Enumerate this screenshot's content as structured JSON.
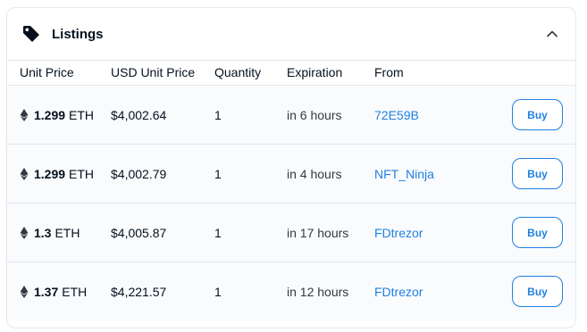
{
  "panel": {
    "title": "Listings",
    "icons": {
      "title": "price-tag-icon",
      "toggle": "chevron-up-icon",
      "currency": "ethereum-icon"
    }
  },
  "columns": [
    "Unit Price",
    "USD Unit Price",
    "Quantity",
    "Expiration",
    "From"
  ],
  "rows": [
    {
      "price": "1.299",
      "currency": "ETH",
      "usd": "$4,002.64",
      "quantity": "1",
      "expiration": "in 6 hours",
      "from": "72E59B",
      "action": "Buy"
    },
    {
      "price": "1.299",
      "currency": "ETH",
      "usd": "$4,002.79",
      "quantity": "1",
      "expiration": "in 4 hours",
      "from": "NFT_Ninja",
      "action": "Buy"
    },
    {
      "price": "1.3",
      "currency": "ETH",
      "usd": "$4,005.87",
      "quantity": "1",
      "expiration": "in 17 hours",
      "from": "FDtrezor",
      "action": "Buy"
    },
    {
      "price": "1.37",
      "currency": "ETH",
      "usd": "$4,221.57",
      "quantity": "1",
      "expiration": "in 12 hours",
      "from": "FDtrezor",
      "action": "Buy"
    }
  ],
  "colors": {
    "link": "#2081e2",
    "text": "#04111d",
    "border": "#e5e8eb",
    "row_bg": "#f9fbfd"
  }
}
